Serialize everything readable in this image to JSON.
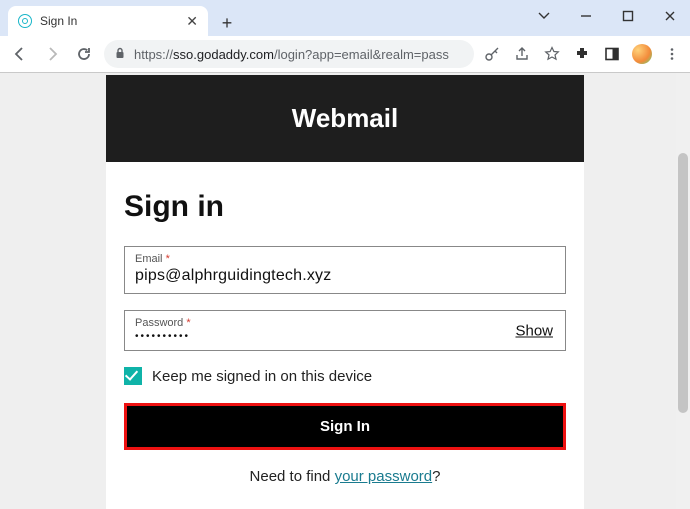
{
  "browser": {
    "tab_title": "Sign In",
    "url_display_prefix": "https://",
    "url_host": "sso.godaddy.com",
    "url_path": "/login?app=email&realm=pass"
  },
  "page": {
    "banner_title": "Webmail",
    "heading": "Sign in",
    "email": {
      "label": "Email",
      "required_mark": "*",
      "value": "pips@alphrguidingtech.xyz"
    },
    "password": {
      "label": "Password",
      "required_mark": "*",
      "mask": "••••••••••",
      "show_label": "Show"
    },
    "remember": {
      "label": "Keep me signed in on this device",
      "checked": true
    },
    "submit_label": "Sign In",
    "forgot": {
      "prefix": "Need to find ",
      "link": "your password",
      "suffix": "?"
    }
  }
}
